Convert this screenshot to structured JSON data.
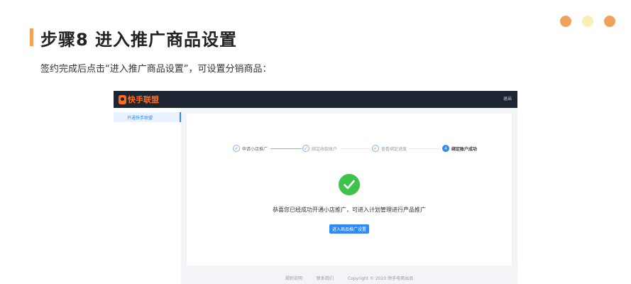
{
  "slide": {
    "title": "步骤8 进入推广商品设置",
    "description": "签约完成后点击“进入推广商品设置”，可设置分销商品："
  },
  "app": {
    "logo_text": "快手联盟",
    "logout_label": "退出",
    "sidebar": {
      "items": [
        {
          "label": "开通快手联盟"
        }
      ]
    },
    "steps": [
      {
        "label": "申请小店推广",
        "status": "done",
        "marker": "✓"
      },
      {
        "label": "绑定收款账户",
        "status": "done",
        "marker": "✓"
      },
      {
        "label": "查看绑定进度",
        "status": "done",
        "marker": "✓"
      },
      {
        "label": "绑定账户成功",
        "status": "active",
        "marker": "4"
      }
    ],
    "success_message": "恭喜您已经成功开通小店推广，可进入计划管理进行产品推广",
    "primary_button_label": "进入商品推广设置",
    "footer": {
      "links": [
        "规则说明",
        "联系我们"
      ],
      "copyright": "Copyright © 2020 快手电商出品"
    }
  },
  "colors": {
    "accent_orange": "#f0a25a",
    "dot_light": "#f7eeb8",
    "brand_orange": "#ff6a1a",
    "topbar": "#1d2533",
    "primary_blue": "#2f8af5",
    "success_green": "#3ec24a"
  }
}
